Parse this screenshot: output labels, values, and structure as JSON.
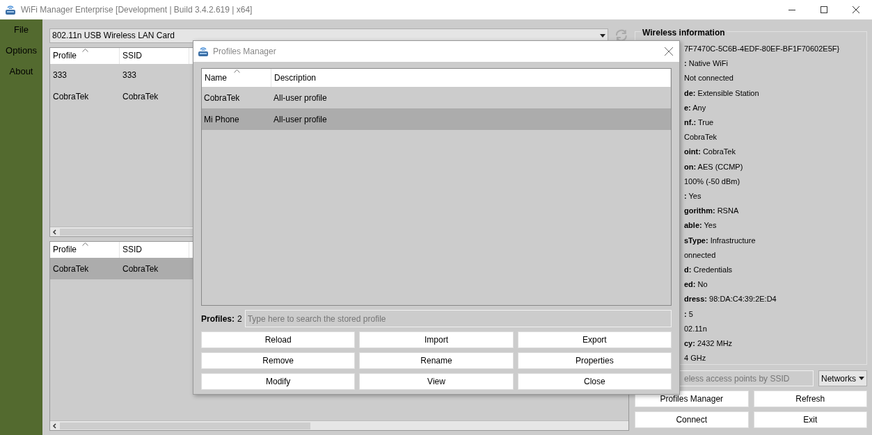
{
  "window": {
    "title": "WiFi Manager Enterprise [Development | Build 3.4.2.619 | x64]"
  },
  "menu": [
    "File",
    "Options",
    "About"
  ],
  "adapter": {
    "value": "802.11n USB Wireless LAN Card"
  },
  "profiles_table": {
    "columns": [
      "Profile",
      "SSID"
    ],
    "rows": [
      {
        "cells": [
          "333",
          "333"
        ],
        "selected": false
      },
      {
        "cells": [
          "CobraTek",
          "CobraTek"
        ],
        "selected": false
      }
    ]
  },
  "connections_table": {
    "columns": [
      "Profile",
      "SSID"
    ],
    "rows": [
      {
        "cells": [
          "CobraTek",
          "CobraTek"
        ],
        "selected": true
      }
    ]
  },
  "wireless_info": {
    "title": "Wireless information",
    "lines": [
      "7F7470C-5C6B-4EDF-80EF-BF1F70602E5F}",
      "**:** Native WiFi",
      "Not connected",
      "**de:** Extensible Station",
      "**e:** Any",
      "**nf.:** True",
      "CobraTek",
      "**oint:** CobraTek",
      "**on:** AES (CCMP)",
      "100% (-50 dBm)",
      "**:** Yes",
      "**gorithm:** RSNA",
      "**able:** Yes",
      "**sType:** Infrastructure",
      "onnected",
      "**d:** Credentials",
      "**ed:** No",
      "**dress:** 98:DA:C4:39:2E:D4",
      "**:** 5",
      "02.11n",
      "**cy:** 2432 MHz",
      "4 GHz"
    ]
  },
  "ssid_search": {
    "placeholder": "eless access points by SSID"
  },
  "view_select": {
    "value": "Networks"
  },
  "main_buttons": [
    "Profiles Manager",
    "Refresh",
    "Connect",
    "Exit"
  ],
  "dialog": {
    "title": "Profiles Manager",
    "columns": [
      "Name",
      "Description"
    ],
    "rows": [
      {
        "cells": [
          "CobraTek",
          "All-user profile"
        ],
        "selected": false
      },
      {
        "cells": [
          "Mi Phone",
          "All-user profile"
        ],
        "selected": true
      }
    ],
    "count_label": "Profiles:",
    "count": "2",
    "search": {
      "placeholder": "Type here to search the stored profile"
    },
    "buttons": [
      "Reload",
      "Import",
      "Export",
      "Remove",
      "Rename",
      "Properties",
      "Modify",
      "View",
      "Close"
    ]
  }
}
